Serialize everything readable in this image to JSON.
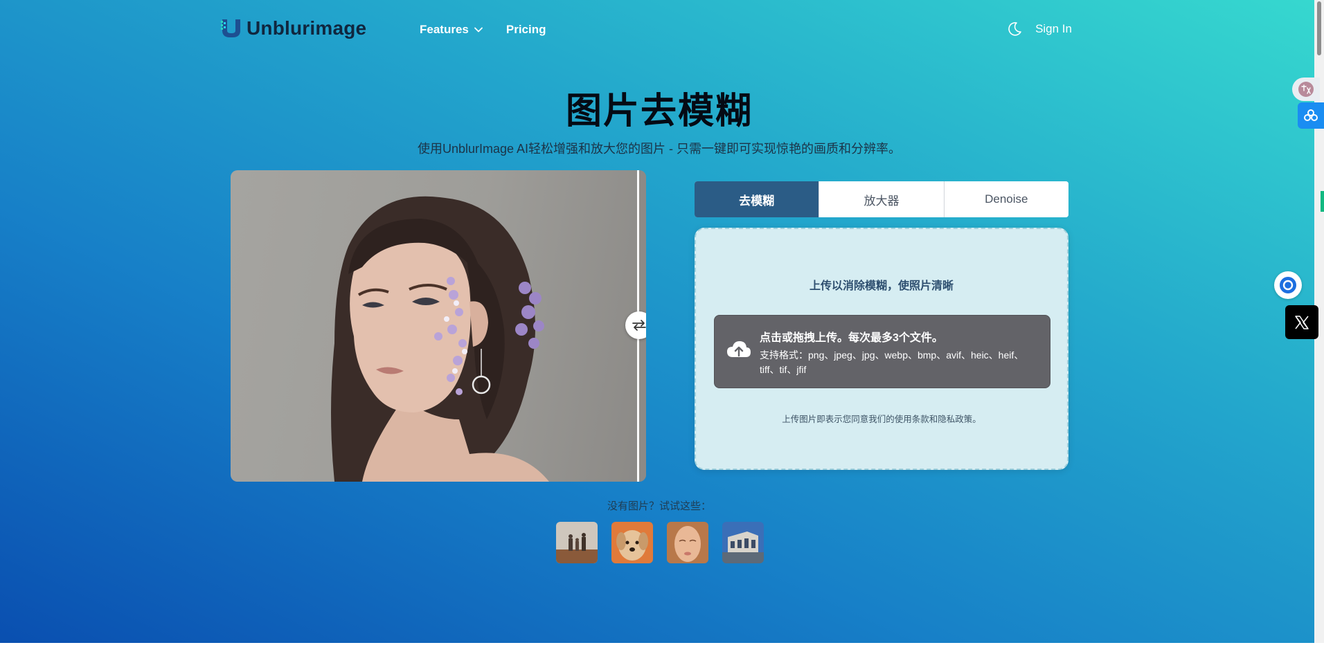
{
  "header": {
    "logo_text": "Unblurimage",
    "nav": [
      {
        "label": "Features",
        "has_dropdown": true
      },
      {
        "label": "Pricing",
        "has_dropdown": false
      }
    ],
    "sign_in_label": "Sign In",
    "theme_icon": "moon-icon"
  },
  "hero": {
    "title": "图片去模糊",
    "subtitle": "使用UnblurImage AI轻松增强和放大您的图片 - 只需一键即可实现惊艳的画质和分辨率。"
  },
  "comparison": {
    "handle_icon": "swap-arrows-icon"
  },
  "tabs": [
    {
      "label": "去模糊",
      "active": true
    },
    {
      "label": "放大器",
      "active": false
    },
    {
      "label": "Denoise",
      "active": false
    }
  ],
  "upload": {
    "title": "上传以消除模糊，使照片清晰",
    "drop_main": "点击或拖拽上传。每次最多3个文件。",
    "drop_formats": "支持格式：png、jpeg、jpg、webp、bmp、avif、heic、heif、tiff、tif、jfif",
    "terms": "上传图片即表示您同意我们的使用条款和隐私政策。",
    "icon": "cloud-upload-icon"
  },
  "samples": {
    "label": "没有图片？试试这些："
  },
  "colors": {
    "tab_active": "#2b5c86",
    "dropzone_bg": "#636368",
    "upload_card_bg": "#d6edf2",
    "gradient_start": "#0a4fb0",
    "gradient_end": "#36d8cf"
  }
}
